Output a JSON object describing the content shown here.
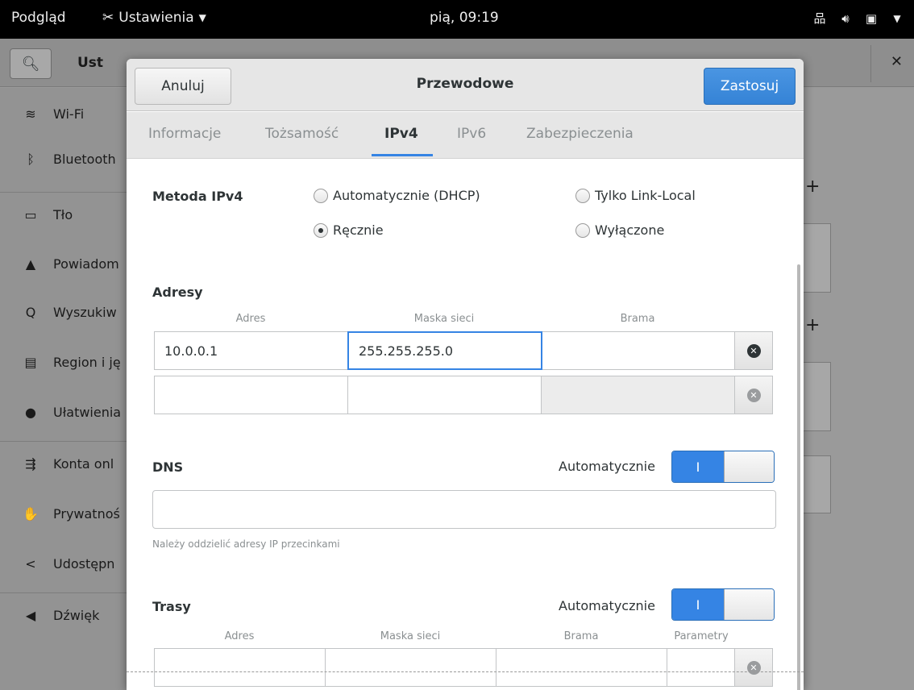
{
  "topbar": {
    "activities": "Podgląd",
    "app_name": "Ustawienia",
    "clock": "pią, 09:19",
    "icons": [
      "network-wired-icon",
      "volume-icon",
      "battery-icon",
      "chevron-down-icon"
    ]
  },
  "settings": {
    "title": "Ust",
    "sidebar": [
      {
        "label": "Wi-Fi",
        "icon": "wifi-icon"
      },
      {
        "label": "Bluetooth",
        "icon": "bluetooth-icon"
      },
      {
        "label": "Tło",
        "icon": "background-icon"
      },
      {
        "label": "Powiadom",
        "icon": "bell-icon"
      },
      {
        "label": "Wyszukiw",
        "icon": "search-icon"
      },
      {
        "label": "Region i ję",
        "icon": "region-icon"
      },
      {
        "label": "Ułatwienia",
        "icon": "accessibility-icon"
      },
      {
        "label": "Konta onl",
        "icon": "online-accounts-icon"
      },
      {
        "label": "Prywatnoś",
        "icon": "privacy-icon"
      },
      {
        "label": "Udostępn",
        "icon": "share-icon"
      },
      {
        "label": "Dźwięk",
        "icon": "sound-icon"
      }
    ]
  },
  "dialog": {
    "title": "Przewodowe",
    "cancel": "Anuluj",
    "apply": "Zastosuj",
    "tabs": [
      "Informacje",
      "Tożsamość",
      "IPv4",
      "IPv6",
      "Zabezpieczenia"
    ],
    "active_tab": "IPv4",
    "method": {
      "label": "Metoda IPv4",
      "options": [
        "Automatycznie (DHCP)",
        "Tylko Link-Local",
        "Ręcznie",
        "Wyłączone"
      ],
      "selected": "Ręcznie"
    },
    "addresses": {
      "label": "Adresy",
      "columns": [
        "Adres",
        "Maska sieci",
        "Brama"
      ],
      "rows": [
        {
          "address": "10.0.0.1",
          "netmask": "255.255.255.0",
          "gateway": ""
        },
        {
          "address": "",
          "netmask": "",
          "gateway": ""
        }
      ]
    },
    "dns": {
      "label": "DNS",
      "auto_label": "Automatycznie",
      "switch_on": "I",
      "value": "",
      "hint": "Należy oddzielić adresy IP przecinkami"
    },
    "routes": {
      "label": "Trasy",
      "auto_label": "Automatycznie",
      "switch_on": "I",
      "columns": [
        "Adres",
        "Maska sieci",
        "Brama",
        "Parametry"
      ]
    }
  },
  "colors": {
    "accent": "#3584e4",
    "topbar": "#000000"
  }
}
